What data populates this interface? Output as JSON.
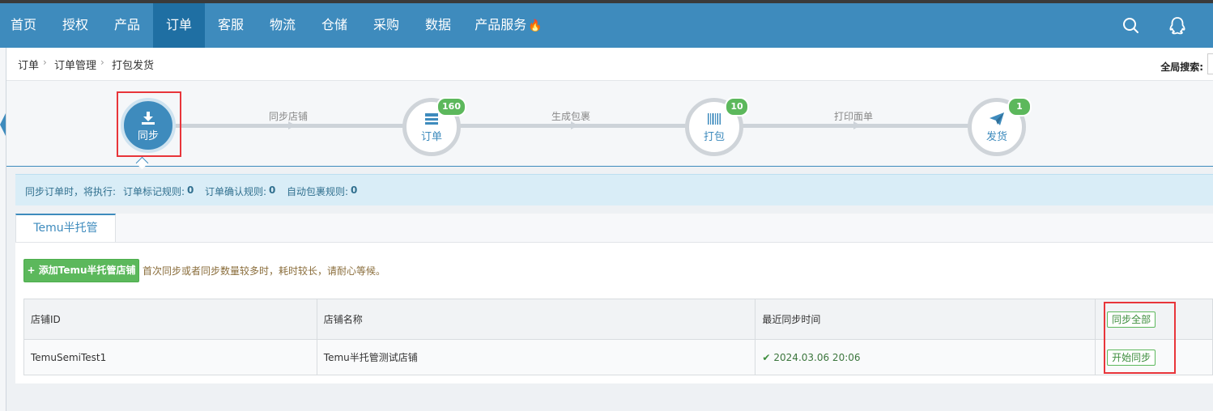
{
  "nav": {
    "items": [
      "首页",
      "授权",
      "产品",
      "订单",
      "客服",
      "物流",
      "仓储",
      "采购",
      "数据",
      "产品服务"
    ],
    "active_index": 3,
    "fire_glyph": "🔥",
    "right_icons": [
      "search-icon",
      "qq-icon"
    ]
  },
  "breadcrumb": {
    "items": [
      "订单",
      "订单管理",
      "打包发货"
    ],
    "separator": "›"
  },
  "global_search": {
    "label": "全局搜索:"
  },
  "steps": {
    "nodes": [
      {
        "label": "同步",
        "badge": null,
        "active": true
      },
      {
        "label": "订单",
        "badge": "160",
        "active": false
      },
      {
        "label": "打包",
        "badge": "10",
        "active": false
      },
      {
        "label": "发货",
        "badge": "1",
        "active": false
      }
    ],
    "connectors": [
      "同步店铺",
      "生成包裹",
      "打印面单"
    ]
  },
  "info": {
    "prefix": "同步订单时，将执行:",
    "rules": [
      {
        "label": "订单标记规则:",
        "value": "0"
      },
      {
        "label": "订单确认规则:",
        "value": "0"
      },
      {
        "label": "自动包裹规则:",
        "value": "0"
      }
    ]
  },
  "tabs": [
    "Temu半托管"
  ],
  "toolbar": {
    "add_button": "添加Temu半托管店铺",
    "add_icon": "+",
    "hint": "首次同步或者同步数量较多时，耗时较长，请耐心等候。"
  },
  "table": {
    "headers": [
      "店铺ID",
      "店铺名称",
      "最近同步时间"
    ],
    "header_action": "同步全部",
    "rows": [
      {
        "id": "TemuSemiTest1",
        "name": "Temu半托管测试店铺",
        "time": "2024.03.06 20:06",
        "action": "开始同步"
      }
    ]
  },
  "colors": {
    "nav": "#3e8bbd",
    "nav_active": "#1f6fa3",
    "badge": "#5cb85c",
    "highlight": "#e8353a"
  }
}
